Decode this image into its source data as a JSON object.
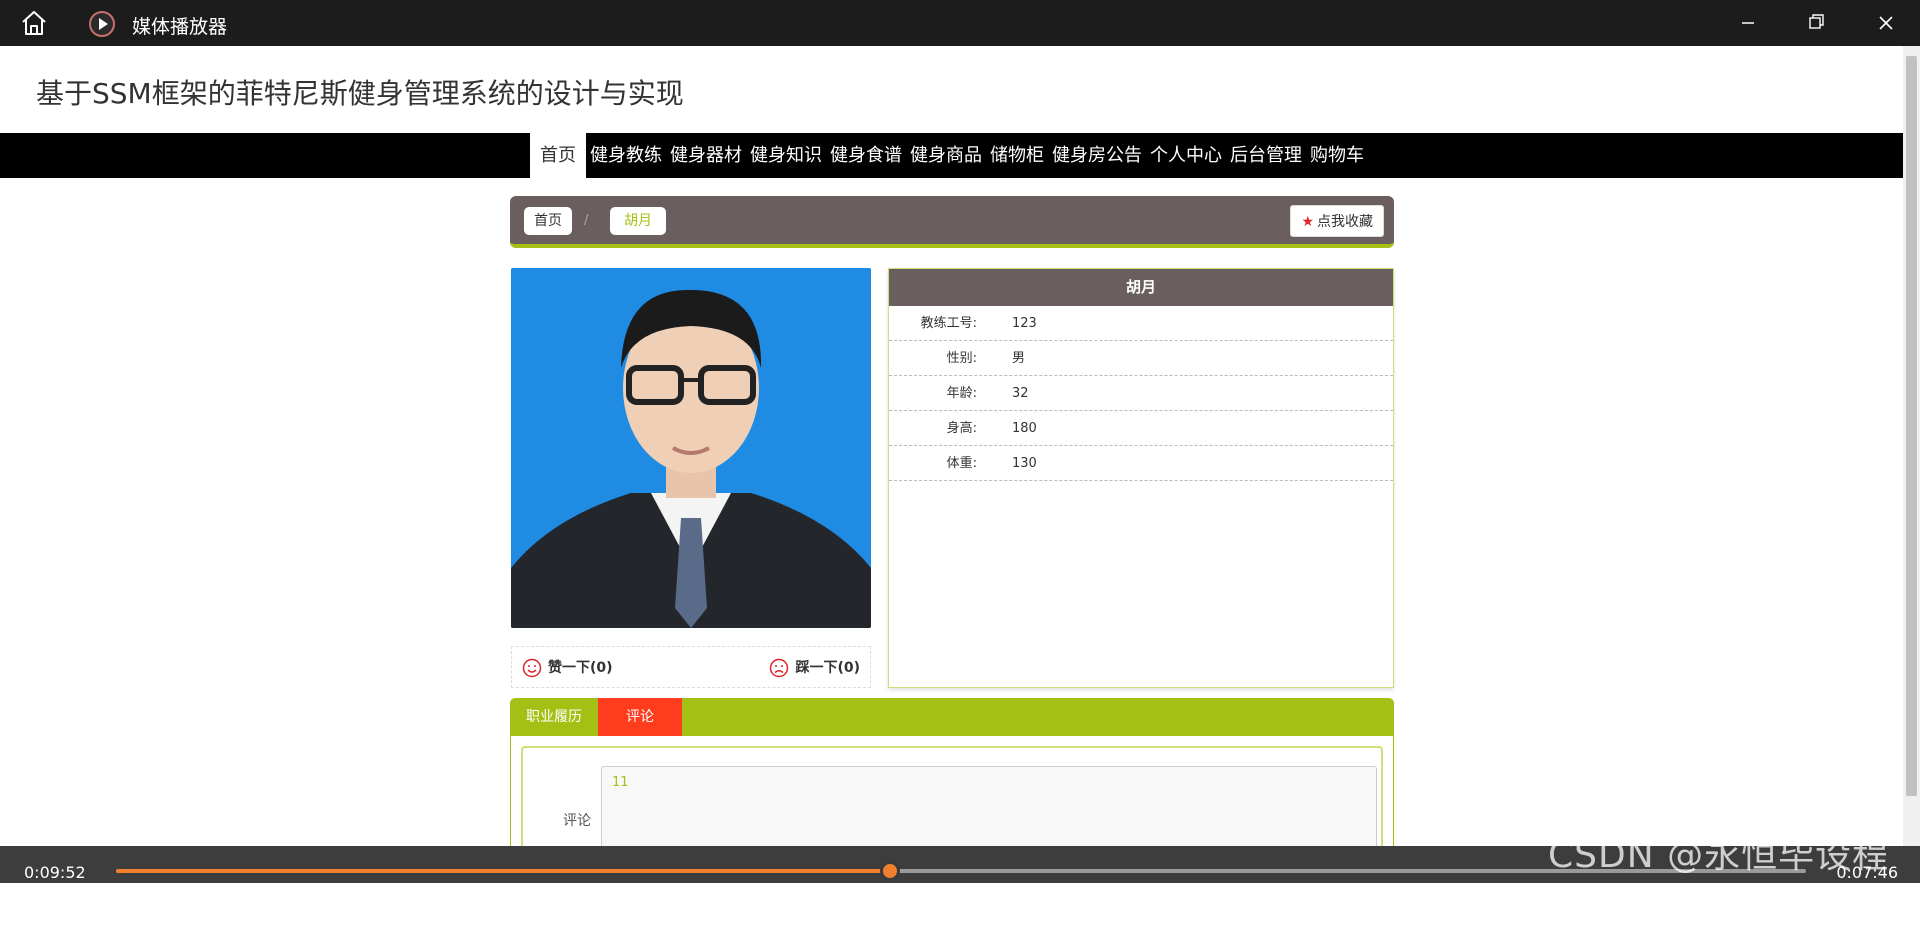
{
  "player": {
    "title": "媒体播放器",
    "elapsed": "0:09:52",
    "remaining": "0:07:46",
    "progress": 0.458,
    "accent": "#f08030"
  },
  "page": {
    "title": "基于SSM框架的菲特尼斯健身管理系统的设计与实现",
    "nav": [
      {
        "label": "首页"
      },
      {
        "label": "健身教练"
      },
      {
        "label": "健身器材"
      },
      {
        "label": "健身知识"
      },
      {
        "label": "健身食谱"
      },
      {
        "label": "健身商品"
      },
      {
        "label": "储物柜"
      },
      {
        "label": "健身房公告"
      },
      {
        "label": "个人中心"
      },
      {
        "label": "后台管理"
      },
      {
        "label": "购物车"
      }
    ],
    "breadcrumb": {
      "home": "首页",
      "separator": "/",
      "current": "胡月"
    },
    "favorite_label": "点我收藏",
    "votes": {
      "up_label": "赞一下(0)",
      "down_label": "踩一下(0)"
    },
    "coach": {
      "name": "胡月",
      "fields": [
        {
          "label": "教练工号:",
          "value": "123"
        },
        {
          "label": "性别:",
          "value": "男"
        },
        {
          "label": "年龄:",
          "value": "32"
        },
        {
          "label": "身高:",
          "value": "180"
        },
        {
          "label": "体重:",
          "value": "130"
        }
      ]
    },
    "tabs": {
      "career": "职业履历",
      "comment": "评论"
    },
    "comment_form": {
      "label": "评论",
      "value": "11"
    },
    "colors": {
      "brand_green": "#a4c014",
      "header_brown": "#6a5e5e",
      "active_tab": "#ff3d1e"
    }
  },
  "watermark": "CSDN @永恒毕设程序"
}
